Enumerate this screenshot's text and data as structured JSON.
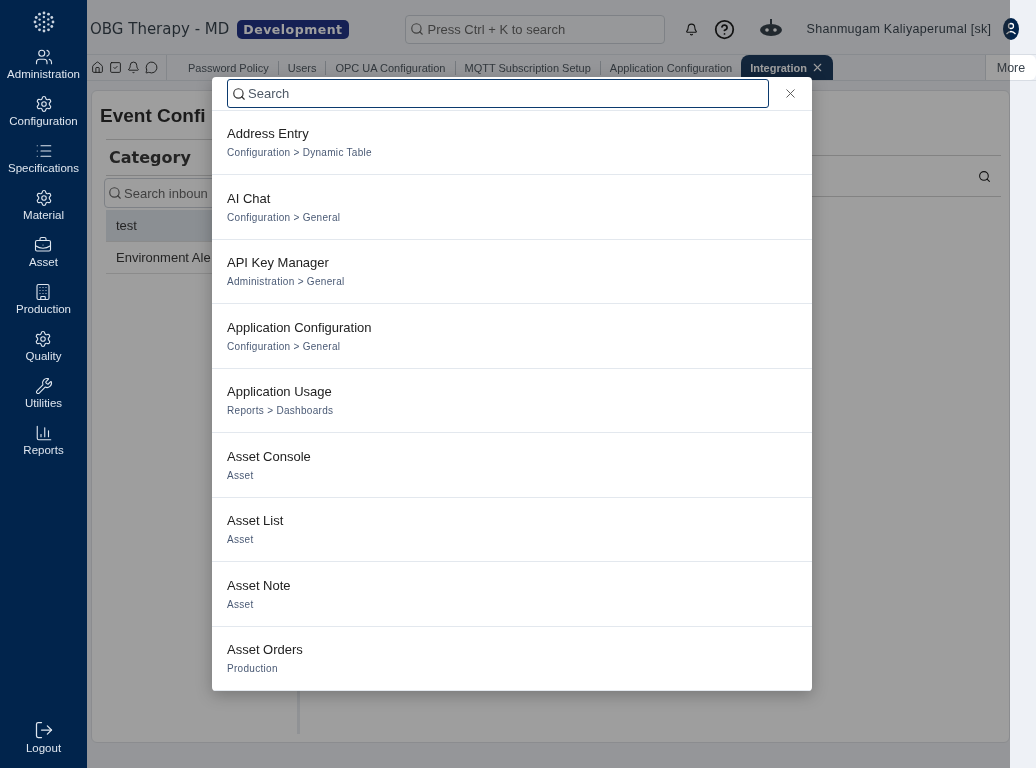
{
  "sidebar": {
    "items": [
      {
        "label": "Administration"
      },
      {
        "label": "Configuration"
      },
      {
        "label": "Specifications"
      },
      {
        "label": "Material"
      },
      {
        "label": "Asset"
      },
      {
        "label": "Production"
      },
      {
        "label": "Quality"
      },
      {
        "label": "Utilities"
      },
      {
        "label": "Reports"
      }
    ],
    "logout": "Logout"
  },
  "header": {
    "title": "OBG Therapy - MD",
    "badge": "Development",
    "search": {
      "placeholder": "Press Ctrl + K to search"
    },
    "user": "Shanmugam Kaliyaperumal [sk]"
  },
  "tabs": [
    {
      "label": "Password Policy",
      "selected": false
    },
    {
      "label": "Users",
      "selected": false
    },
    {
      "label": "OPC UA Configuration",
      "selected": false
    },
    {
      "label": "MQTT Subscription Setup",
      "selected": false
    },
    {
      "label": "Application Configuration",
      "selected": false
    },
    {
      "label": "Integration",
      "selected": true
    }
  ],
  "more": "More",
  "page": {
    "title": "Event Confi",
    "category": {
      "heading": "Category",
      "search": {
        "placeholder": "Search inboun"
      },
      "items": [
        {
          "label": "test",
          "selected": true
        },
        {
          "label": "Environment Ale",
          "selected": false
        }
      ]
    }
  },
  "dialog": {
    "search": {
      "placeholder": "Search"
    },
    "results": [
      {
        "title": "Address Entry",
        "path": "Configuration > Dynamic Table"
      },
      {
        "title": "AI Chat",
        "path": "Configuration > General"
      },
      {
        "title": "API Key Manager",
        "path": "Administration > General"
      },
      {
        "title": "Application Configuration",
        "path": "Configuration > General"
      },
      {
        "title": "Application Usage",
        "path": "Reports > Dashboards"
      },
      {
        "title": "Asset Console",
        "path": "Asset"
      },
      {
        "title": "Asset List",
        "path": "Asset"
      },
      {
        "title": "Asset Note",
        "path": "Asset"
      },
      {
        "title": "Asset Orders",
        "path": "Production"
      }
    ]
  }
}
